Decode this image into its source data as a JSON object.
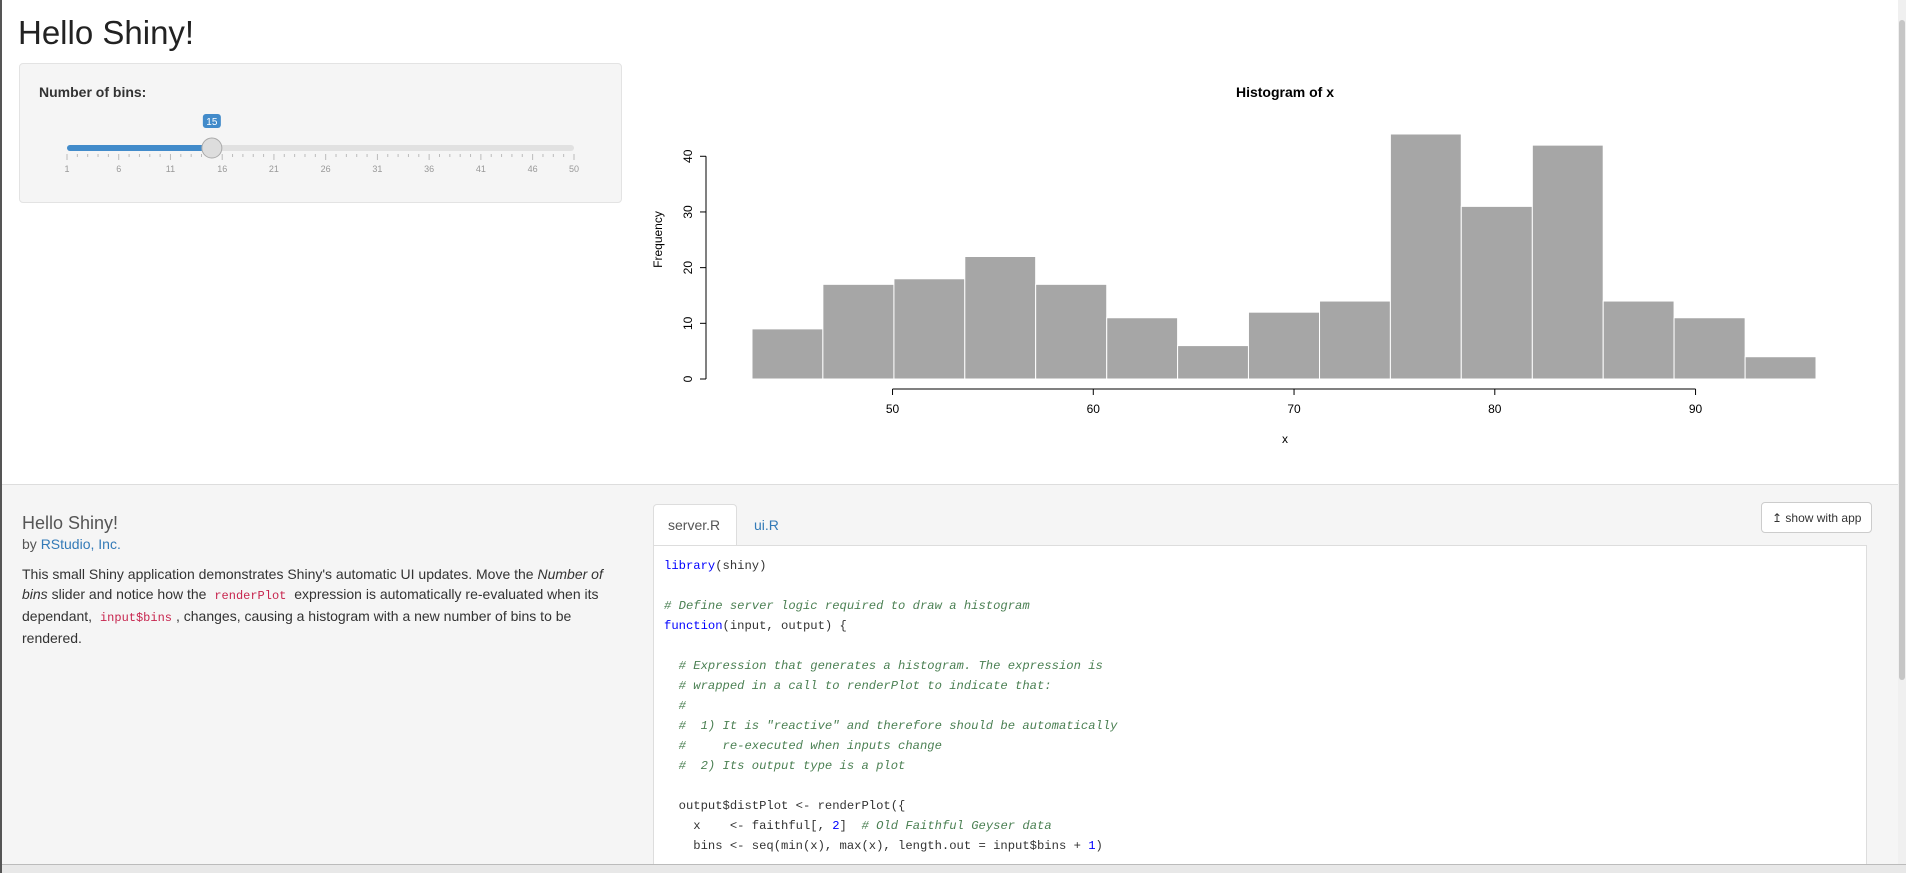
{
  "page": {
    "title": "Hello Shiny!"
  },
  "sidebar": {
    "slider_label": "Number of bins:",
    "slider": {
      "min": 1,
      "max": 50,
      "value": 15,
      "ticks": [
        "1",
        "6",
        "11",
        "16",
        "21",
        "26",
        "31",
        "36",
        "41",
        "46",
        "50"
      ],
      "accent": "#428bca"
    }
  },
  "chart_data": {
    "type": "bar",
    "title": "Histogram of x",
    "xlabel": "x",
    "ylabel": "Frequency",
    "bin_edges": [
      43.0,
      46.53,
      50.07,
      53.6,
      57.13,
      60.67,
      64.2,
      67.73,
      71.27,
      74.8,
      78.33,
      81.87,
      85.4,
      88.93,
      92.47,
      96.0
    ],
    "values": [
      9,
      17,
      18,
      22,
      17,
      11,
      6,
      12,
      14,
      44,
      31,
      42,
      14,
      11,
      4
    ],
    "x_ticks": [
      50,
      60,
      70,
      80,
      90
    ],
    "y_ticks": [
      0,
      10,
      20,
      30,
      40
    ],
    "bar_color": "#a6a6a6"
  },
  "description": {
    "title": "Hello Shiny!",
    "by_prefix": "by",
    "author": "RStudio, Inc.",
    "text_1": "This small Shiny application demonstrates Shiny's automatic UI updates. Move the",
    "text_em1": "Number of bins",
    "text_2": "slider and notice how the",
    "code_1": "renderPlot",
    "text_3": "expression is automatically re-evaluated when its dependant,",
    "code_2": "input$bins",
    "text_4": ", changes, causing a histogram with a new number of bins to be rendered."
  },
  "code_panel": {
    "tabs": [
      {
        "label": "server.R",
        "active": true
      },
      {
        "label": "ui.R",
        "active": false
      }
    ],
    "show_button": "show with app",
    "lines": [
      [
        [
          "kw",
          "library"
        ],
        [
          "t",
          "(shiny)"
        ]
      ],
      [],
      [
        [
          "cm",
          "# Define server logic required to draw a histogram"
        ]
      ],
      [
        [
          "kw",
          "function"
        ],
        [
          "t",
          "(input, output) {"
        ]
      ],
      [],
      [
        [
          "cm",
          "  # Expression that generates a histogram. The expression is"
        ]
      ],
      [
        [
          "cm",
          "  # wrapped in a call to renderPlot to indicate that:"
        ]
      ],
      [
        [
          "cm",
          "  #"
        ]
      ],
      [
        [
          "cm",
          "  #  1) It is \"reactive\" and therefore should be automatically"
        ]
      ],
      [
        [
          "cm",
          "  #     re-executed when inputs change"
        ]
      ],
      [
        [
          "cm",
          "  #  2) Its output type is a plot"
        ]
      ],
      [],
      [
        [
          "t",
          "  output$distPlot <- renderPlot({"
        ]
      ],
      [
        [
          "t",
          "    x    <- faithful[, "
        ],
        [
          "nm",
          "2"
        ],
        [
          "t",
          "]  "
        ],
        [
          "cm",
          "# Old Faithful Geyser data"
        ]
      ],
      [
        [
          "t",
          "    bins <- seq(min(x), max(x), length.out = input$bins + "
        ],
        [
          "nm",
          "1"
        ],
        [
          "t",
          ")"
        ]
      ]
    ]
  }
}
